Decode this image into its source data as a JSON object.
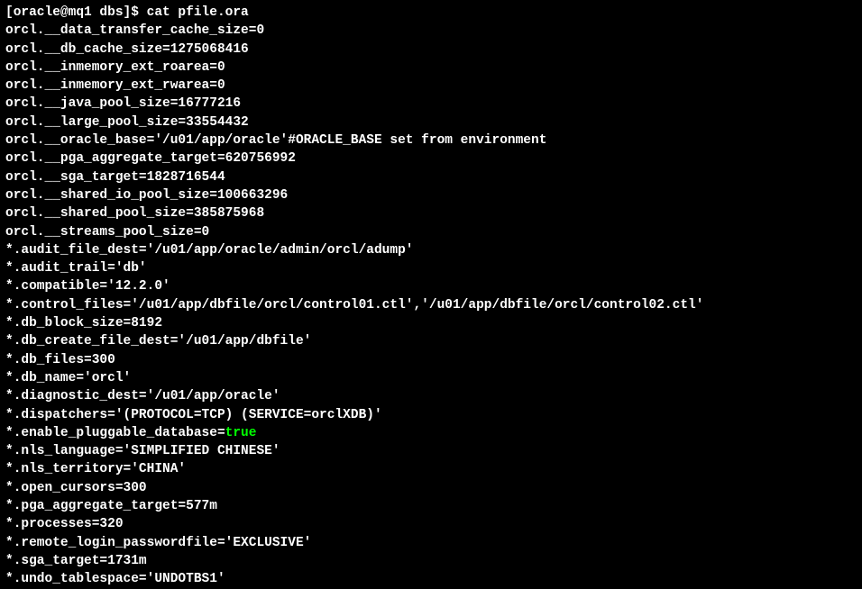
{
  "prompt": "[oracle@mq1 dbs]$ cat pfile.ora",
  "lines": [
    "orcl.__data_transfer_cache_size=0",
    "orcl.__db_cache_size=1275068416",
    "orcl.__inmemory_ext_roarea=0",
    "orcl.__inmemory_ext_rwarea=0",
    "orcl.__java_pool_size=16777216",
    "orcl.__large_pool_size=33554432",
    "orcl.__oracle_base='/u01/app/oracle'#ORACLE_BASE set from environment",
    "orcl.__pga_aggregate_target=620756992",
    "orcl.__sga_target=1828716544",
    "orcl.__shared_io_pool_size=100663296",
    "orcl.__shared_pool_size=385875968",
    "orcl.__streams_pool_size=0",
    "*.audit_file_dest='/u01/app/oracle/admin/orcl/adump'",
    "*.audit_trail='db'",
    "*.compatible='12.2.0'",
    "*.control_files='/u01/app/dbfile/orcl/control01.ctl','/u01/app/dbfile/orcl/control02.ctl'",
    "*.db_block_size=8192",
    "*.db_create_file_dest='/u01/app/dbfile'",
    "*.db_files=300",
    "*.db_name='orcl'",
    "*.diagnostic_dest='/u01/app/oracle'",
    "*.dispatchers='(PROTOCOL=TCP) (SERVICE=orclXDB)'"
  ],
  "pluggable_prefix": "*.enable_pluggable_database=",
  "pluggable_value": "true",
  "lines_after": [
    "*.nls_language='SIMPLIFIED CHINESE'",
    "*.nls_territory='CHINA'",
    "*.open_cursors=300",
    "*.pga_aggregate_target=577m",
    "*.processes=320",
    "*.remote_login_passwordfile='EXCLUSIVE'",
    "*.sga_target=1731m",
    "*.undo_tablespace='UNDOTBS1'"
  ]
}
